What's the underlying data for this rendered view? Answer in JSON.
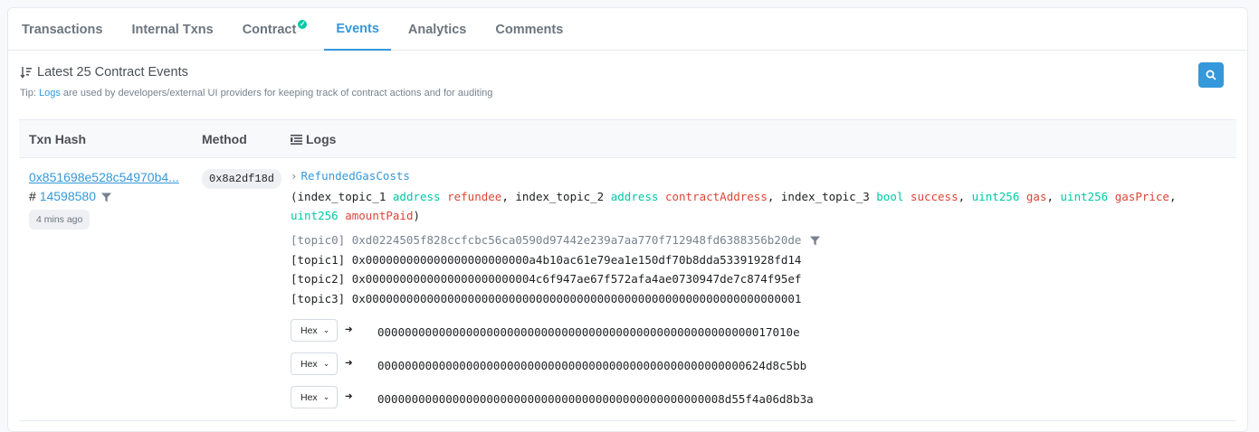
{
  "tabs": [
    {
      "label": "Transactions"
    },
    {
      "label": "Internal Txns"
    },
    {
      "label": "Contract"
    },
    {
      "label": "Events"
    },
    {
      "label": "Analytics"
    },
    {
      "label": "Comments"
    }
  ],
  "active_tab": "Events",
  "header": {
    "title": "Latest 25 Contract Events",
    "tip_prefix": "Tip:",
    "tip_link": "Logs",
    "tip_rest": "are used by developers/external UI providers for keeping track of contract actions and for auditing"
  },
  "table": {
    "col_txn": "Txn Hash",
    "col_method": "Method",
    "col_logs": "Logs"
  },
  "row": {
    "txn_hash": "0x851698e528c54970b4...",
    "block_prefix": "#",
    "block_number": "14598580",
    "age": "4 mins ago",
    "method": "0x8a2df18d",
    "event_name": "RefundedGasCosts",
    "sig_open": "(index_topic_1",
    "sig_t1": "address",
    "sig_p1": "refundee",
    "sig_s2": ", index_topic_2",
    "sig_t2": "address",
    "sig_p2": "contractAddress",
    "sig_s3": ", index_topic_3",
    "sig_t3": "bool",
    "sig_p3": "success",
    "sig_t4": "uint256",
    "sig_p4": "gas",
    "sig_t5": "uint256",
    "sig_p5": "gasPrice",
    "sig_t6": "uint256",
    "sig_p6": "amountPaid",
    "sig_close": ")",
    "topics": [
      "[topic0] 0xd0224505f828ccfcbc56ca0590d97442e239a7aa770f712948fd6388356b20de",
      "[topic1] 0x000000000000000000000000a4b10ac61e79ea1e150df70b8dda53391928fd14",
      "[topic2] 0x0000000000000000000000004c6f947ae67f572afa4ae0730947de7c874f95ef",
      "[topic3] 0x0000000000000000000000000000000000000000000000000000000000000001"
    ],
    "data": [
      {
        "format": "Hex",
        "value": "0000000000000000000000000000000000000000000000000000000017010e"
      },
      {
        "format": "Hex",
        "value": "000000000000000000000000000000000000000000000000000000624d8c5bb"
      },
      {
        "format": "Hex",
        "value": "000000000000000000000000000000000000000000000000008d55f4a06d8b3a"
      }
    ]
  },
  "colors": {
    "accent": "#3498db",
    "type": "#00c9a7",
    "param": "#de4437"
  }
}
